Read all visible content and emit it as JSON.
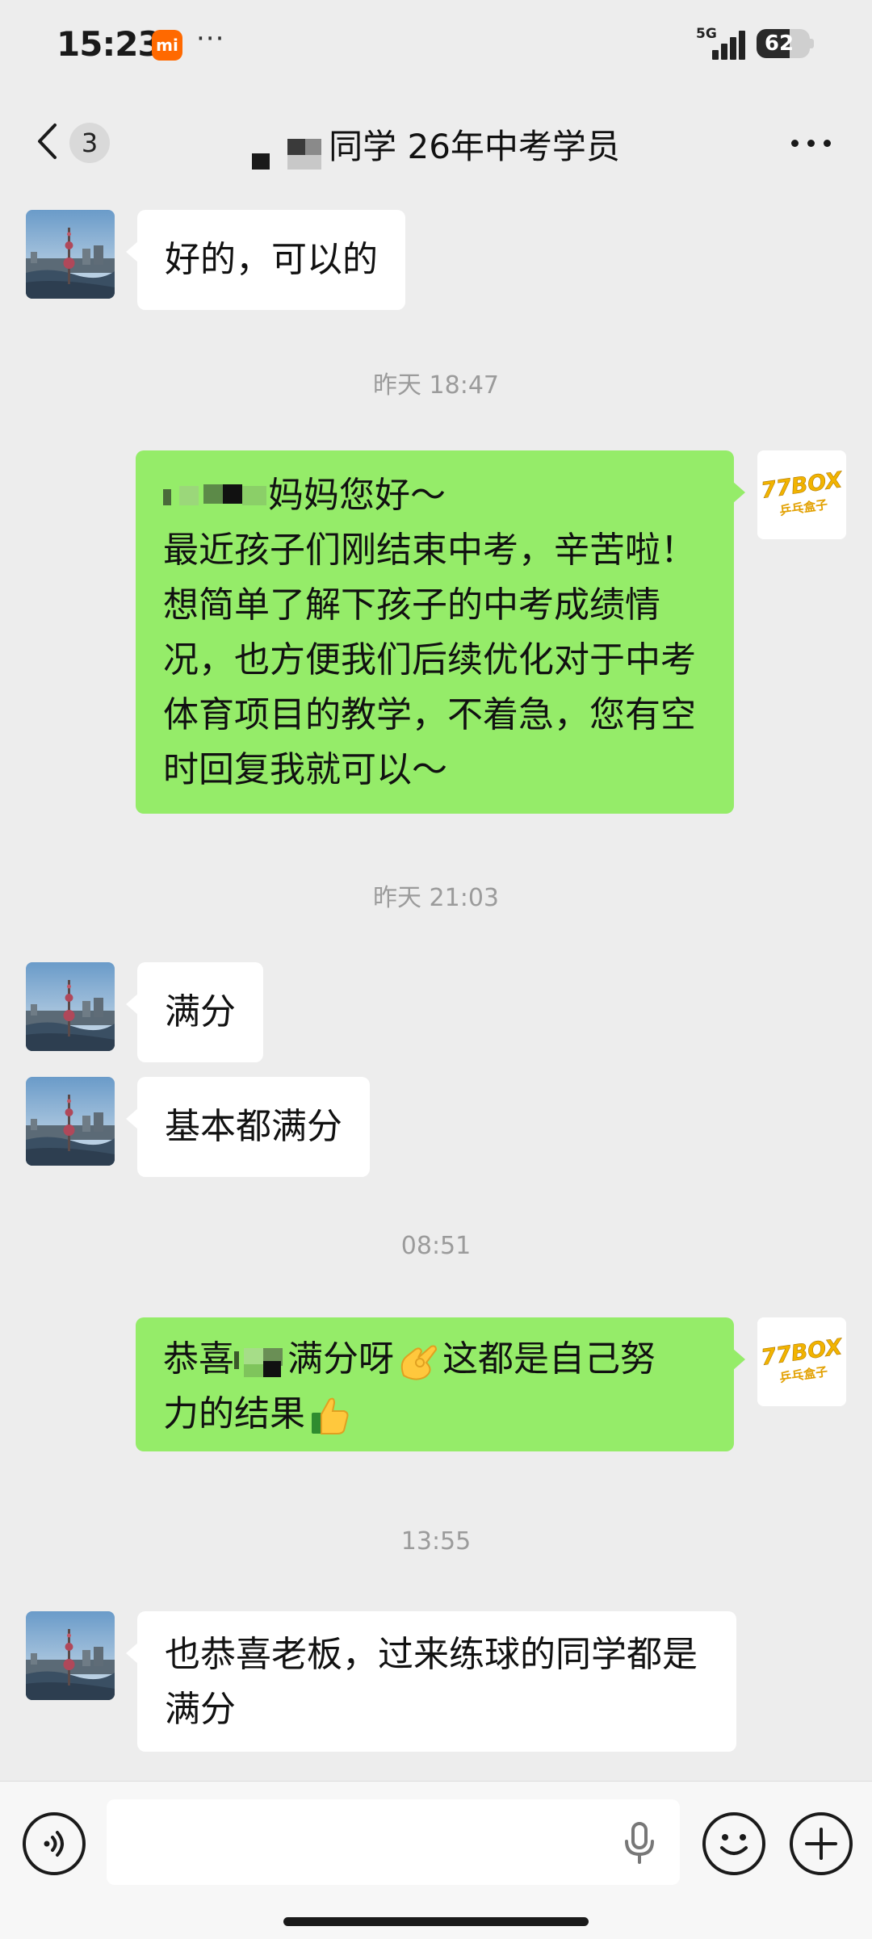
{
  "status_bar": {
    "time": "15:23",
    "xiaomi_badge": "mi",
    "notification_more": "···",
    "network": "5G",
    "battery_level": "62",
    "battery_fraction": 0.62
  },
  "header": {
    "unread_count": "3",
    "title": "同学 26年中考学员"
  },
  "messages": [
    {
      "direction": "incoming",
      "lines": [
        "好的，可以的"
      ]
    },
    {
      "type": "timestamp",
      "text": "昨天 18:47"
    },
    {
      "direction": "outgoing",
      "lines": [
        "妈妈您好～",
        "最近孩子们刚结束中考，辛苦啦！",
        "想简单了解下孩子的中考成绩情",
        "况，也方便我们后续优化对于中考",
        "体育项目的教学，不着急，您有空",
        "时回复我就可以～"
      ]
    },
    {
      "type": "timestamp",
      "text": "昨天 21:03"
    },
    {
      "direction": "incoming",
      "lines": [
        "满分"
      ]
    },
    {
      "direction": "incoming",
      "lines": [
        "基本都满分"
      ]
    },
    {
      "type": "timestamp",
      "text": "08:51"
    },
    {
      "direction": "outgoing",
      "parts": [
        "恭喜",
        "满分呀",
        "这都是自己努",
        "力的结果"
      ]
    },
    {
      "type": "timestamp",
      "text": "13:55"
    },
    {
      "direction": "incoming",
      "lines": [
        "也恭喜老板，过来练球的同学都是",
        "满分"
      ]
    }
  ],
  "brand_avatar": {
    "line1": "77BOX",
    "line2": "乒乓盒子"
  },
  "input_bar": {
    "placeholder": "",
    "icons": [
      "voice-icon",
      "microphone-icon",
      "emoji-icon",
      "plus-icon"
    ]
  },
  "colors": {
    "background": "#ededed",
    "incoming_bubble": "#ffffff",
    "outgoing_bubble": "#95ec69",
    "timestamp": "#9b9b9b",
    "brand": "#f2b400"
  }
}
